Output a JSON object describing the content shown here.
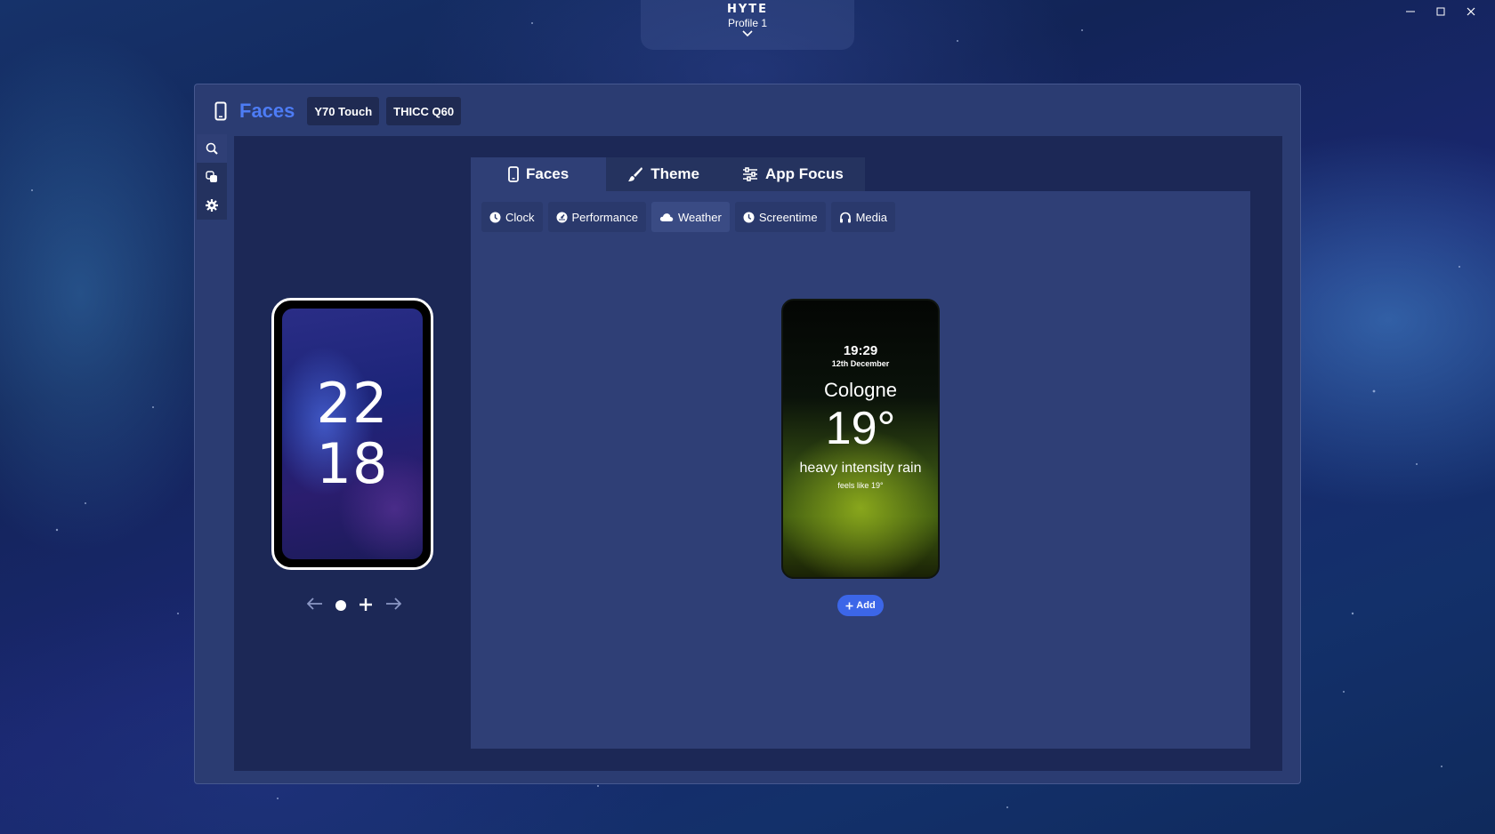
{
  "app": {
    "brand": "HYTE",
    "profile": "Profile 1"
  },
  "window_controls": {
    "minimize": "─",
    "maximize": "☐",
    "close": "✕"
  },
  "header": {
    "title": "Faces",
    "devices": [
      "Y70 Touch",
      "THICC Q60"
    ]
  },
  "preview": {
    "hours": "22",
    "minutes": "18"
  },
  "tabs": [
    {
      "label": "Faces",
      "icon": "phone-icon"
    },
    {
      "label": "Theme",
      "icon": "brush-icon"
    },
    {
      "label": "App Focus",
      "icon": "sliders-icon"
    }
  ],
  "categories": [
    {
      "label": "Clock",
      "icon": "clock-icon"
    },
    {
      "label": "Performance",
      "icon": "gauge-icon"
    },
    {
      "label": "Weather",
      "icon": "cloud-icon"
    },
    {
      "label": "Screentime",
      "icon": "clock-icon"
    },
    {
      "label": "Media",
      "icon": "headphones-icon"
    }
  ],
  "weather_face": {
    "time": "19:29",
    "date": "12th December",
    "city": "Cologne",
    "temperature": "19°",
    "description": "heavy intensity rain",
    "feels_like": "feels like 19°"
  },
  "add_button": {
    "label": "Add"
  }
}
